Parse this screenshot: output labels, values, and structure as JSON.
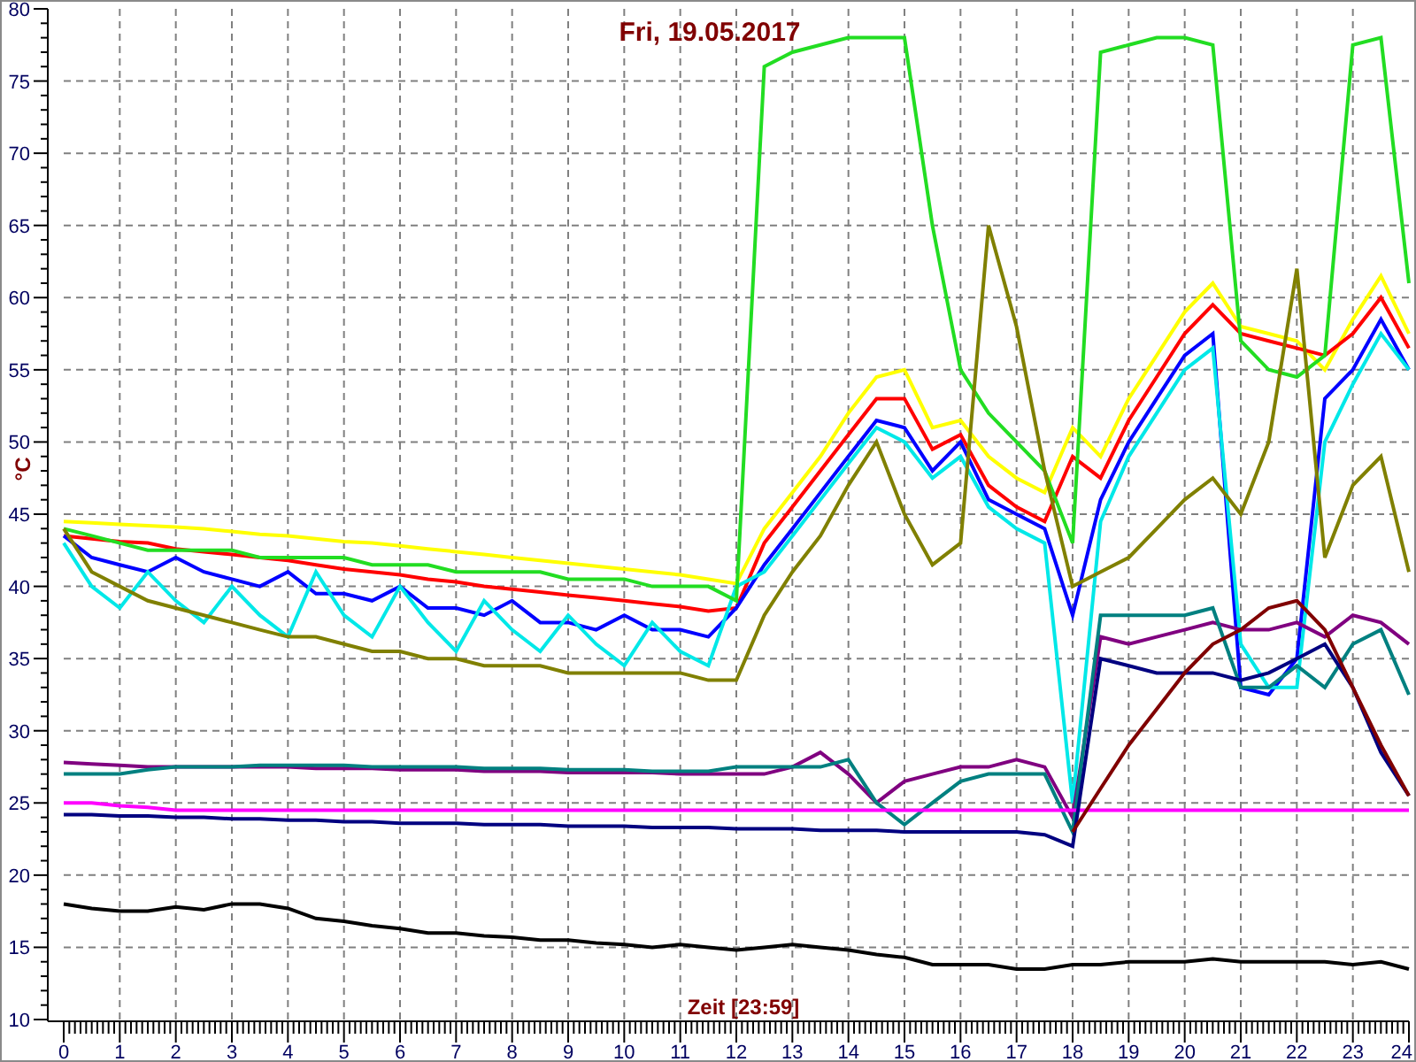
{
  "chart_data": {
    "type": "line",
    "title": "Fri, 19.05.2017",
    "xlabel": "Zeit [23:59]",
    "ylabel": "°C",
    "x": [
      0,
      0.5,
      1,
      1.5,
      2,
      2.5,
      3,
      3.5,
      4,
      4.5,
      5,
      5.5,
      6,
      6.5,
      7,
      7.5,
      8,
      8.5,
      9,
      9.5,
      10,
      10.5,
      11,
      11.5,
      12,
      12.5,
      13,
      13.5,
      14,
      14.5,
      15,
      15.5,
      16,
      16.5,
      17,
      17.5,
      18,
      18.5,
      19,
      19.5,
      20,
      20.5,
      21,
      21.5,
      22,
      22.5,
      23,
      23.5,
      24
    ],
    "grid": true,
    "xlim": [
      0,
      24
    ],
    "ylim": [
      10,
      80
    ],
    "xticks": [
      0,
      1,
      2,
      3,
      4,
      5,
      6,
      7,
      8,
      9,
      10,
      11,
      12,
      13,
      14,
      15,
      16,
      17,
      18,
      19,
      20,
      21,
      22,
      23,
      24
    ],
    "yticks": [
      10,
      15,
      20,
      25,
      30,
      35,
      40,
      45,
      50,
      55,
      60,
      65,
      70,
      75,
      80
    ],
    "series": [
      {
        "color": "#ffff00",
        "values": [
          44.5,
          44.4,
          44.3,
          44.2,
          44.1,
          44,
          43.8,
          43.6,
          43.5,
          43.3,
          43.1,
          43,
          42.8,
          42.6,
          42.4,
          42.2,
          42,
          41.8,
          41.6,
          41.4,
          41.2,
          41,
          40.8,
          40.5,
          40.2,
          44,
          46.5,
          49,
          52,
          54.5,
          55,
          51,
          51.5,
          49,
          47.5,
          46.5,
          51,
          49,
          53,
          56,
          59,
          61,
          58,
          57.5,
          57,
          55,
          58.5,
          61.5,
          57.5
        ]
      },
      {
        "color": "#ff0000",
        "values": [
          43.5,
          43.3,
          43.1,
          43,
          42.6,
          42.4,
          42.2,
          42,
          41.8,
          41.5,
          41.2,
          41,
          40.8,
          40.5,
          40.3,
          40,
          39.8,
          39.6,
          39.4,
          39.2,
          39,
          38.8,
          38.6,
          38.3,
          38.5,
          43,
          45.5,
          48,
          50.5,
          53,
          53,
          49.5,
          50.5,
          47,
          45.5,
          44.5,
          49,
          47.5,
          51.5,
          54.5,
          57.5,
          59.5,
          57.5,
          57,
          56.5,
          56,
          57.5,
          60,
          56.5
        ]
      },
      {
        "color": "#0000ff",
        "values": [
          43.5,
          42,
          41.5,
          41,
          42,
          41,
          40.5,
          40,
          41,
          39.5,
          39.5,
          39,
          40,
          38.5,
          38.5,
          38,
          39,
          37.5,
          37.5,
          37,
          38,
          37,
          37,
          36.5,
          38.5,
          41.5,
          44,
          46.5,
          49,
          51.5,
          51,
          48,
          50,
          46,
          45,
          44,
          38,
          46,
          50,
          53,
          56,
          57.5,
          33,
          32.5,
          35,
          53,
          55,
          58.5,
          55
        ]
      },
      {
        "color": "#00e8e8",
        "values": [
          43,
          40,
          38.5,
          41,
          39,
          37.5,
          40,
          38,
          36.5,
          41,
          38,
          36.5,
          40,
          37.5,
          35.5,
          39,
          37,
          35.5,
          38,
          36,
          34.5,
          37.5,
          35.5,
          34.5,
          40,
          41,
          43.5,
          46,
          48.5,
          51,
          50,
          47.5,
          49,
          45.5,
          44,
          43,
          25,
          44.5,
          49,
          52,
          55,
          56.5,
          36,
          33,
          33,
          50,
          54,
          57.5,
          55
        ]
      },
      {
        "color": "#22dd22",
        "values": [
          44,
          43.5,
          43,
          42.5,
          42.5,
          42.5,
          42.5,
          42,
          42,
          42,
          42,
          41.5,
          41.5,
          41.5,
          41,
          41,
          41,
          41,
          40.5,
          40.5,
          40.5,
          40,
          40,
          40,
          39,
          76,
          77,
          77.5,
          78,
          78,
          78,
          65,
          55,
          52,
          50,
          48,
          43,
          77,
          77.5,
          78,
          78,
          77.5,
          57,
          55,
          54.5,
          56,
          77.5,
          78,
          61
        ]
      },
      {
        "color": "#808000",
        "values": [
          44,
          41,
          40,
          39,
          38.5,
          38,
          37.5,
          37,
          36.5,
          36.5,
          36,
          35.5,
          35.5,
          35,
          35,
          34.5,
          34.5,
          34.5,
          34,
          34,
          34,
          34,
          34,
          33.5,
          33.5,
          38,
          41,
          43.5,
          47,
          50,
          45,
          41.5,
          43,
          65,
          58,
          48,
          40,
          41,
          42,
          44,
          46,
          47.5,
          45,
          50,
          62,
          42,
          47,
          49,
          41
        ]
      },
      {
        "color": "#800080",
        "values": [
          27.8,
          27.7,
          27.6,
          27.5,
          27.5,
          27.5,
          27.5,
          27.5,
          27.5,
          27.4,
          27.4,
          27.4,
          27.3,
          27.3,
          27.3,
          27.2,
          27.2,
          27.2,
          27.1,
          27.1,
          27.1,
          27.1,
          27,
          27,
          27,
          27,
          27.5,
          28.5,
          27,
          25,
          26.5,
          27,
          27.5,
          27.5,
          28,
          27.5,
          24,
          36.5,
          36,
          36.5,
          37,
          37.5,
          37,
          37,
          37.5,
          36.5,
          38,
          37.5,
          36
        ]
      },
      {
        "color": "#008080",
        "values": [
          27,
          27,
          27,
          27.3,
          27.5,
          27.5,
          27.5,
          27.6,
          27.6,
          27.6,
          27.6,
          27.5,
          27.5,
          27.5,
          27.5,
          27.4,
          27.4,
          27.4,
          27.3,
          27.3,
          27.3,
          27.2,
          27.2,
          27.2,
          27.5,
          27.5,
          27.5,
          27.5,
          28,
          25,
          23.5,
          25,
          26.5,
          27,
          27,
          27,
          23,
          38,
          38,
          38,
          38,
          38.5,
          33,
          33,
          34.5,
          33,
          36,
          37,
          32.5
        ]
      },
      {
        "color": "#ff00ff",
        "values": [
          25,
          25,
          24.8,
          24.7,
          24.5,
          24.5,
          24.5,
          24.5,
          24.5,
          24.5,
          24.5,
          24.5,
          24.5,
          24.5,
          24.5,
          24.5,
          24.5,
          24.5,
          24.5,
          24.5,
          24.5,
          24.5,
          24.5,
          24.5,
          24.5,
          24.5,
          24.5,
          24.5,
          24.5,
          24.5,
          24.5,
          24.5,
          24.5,
          24.5,
          24.5,
          24.5,
          24.5,
          24.5,
          24.5,
          24.5,
          24.5,
          24.5,
          24.5,
          24.5,
          24.5,
          24.5,
          24.5,
          24.5,
          24.5
        ]
      },
      {
        "color": "#000080",
        "values": [
          24.2,
          24.2,
          24.1,
          24.1,
          24,
          24,
          23.9,
          23.9,
          23.8,
          23.8,
          23.7,
          23.7,
          23.6,
          23.6,
          23.6,
          23.5,
          23.5,
          23.5,
          23.4,
          23.4,
          23.4,
          23.3,
          23.3,
          23.3,
          23.2,
          23.2,
          23.2,
          23.1,
          23.1,
          23.1,
          23,
          23,
          23,
          23,
          23,
          22.8,
          22,
          35,
          34.5,
          34,
          34,
          34,
          33.5,
          34,
          35,
          36,
          33,
          28.5,
          25.5
        ]
      },
      {
        "color": "#800000",
        "values": [
          null,
          null,
          null,
          null,
          null,
          null,
          null,
          null,
          null,
          null,
          null,
          null,
          null,
          null,
          null,
          null,
          null,
          null,
          null,
          null,
          null,
          null,
          null,
          null,
          null,
          null,
          null,
          null,
          null,
          null,
          null,
          null,
          null,
          null,
          null,
          null,
          23,
          26,
          29,
          31.5,
          34,
          36,
          37,
          38.5,
          39,
          37,
          33,
          29,
          25.5
        ]
      },
      {
        "color": "#000000",
        "values": [
          18,
          17.7,
          17.5,
          17.5,
          17.8,
          17.6,
          18,
          18,
          17.7,
          17,
          16.8,
          16.5,
          16.3,
          16,
          16,
          15.8,
          15.7,
          15.5,
          15.5,
          15.3,
          15.2,
          15,
          15.2,
          15,
          14.8,
          15,
          15.2,
          15,
          14.8,
          14.5,
          14.3,
          13.8,
          13.8,
          13.8,
          13.5,
          13.5,
          13.8,
          13.8,
          14,
          14,
          14,
          14.2,
          14,
          14,
          14,
          14,
          13.8,
          14,
          13.5
        ]
      }
    ]
  }
}
